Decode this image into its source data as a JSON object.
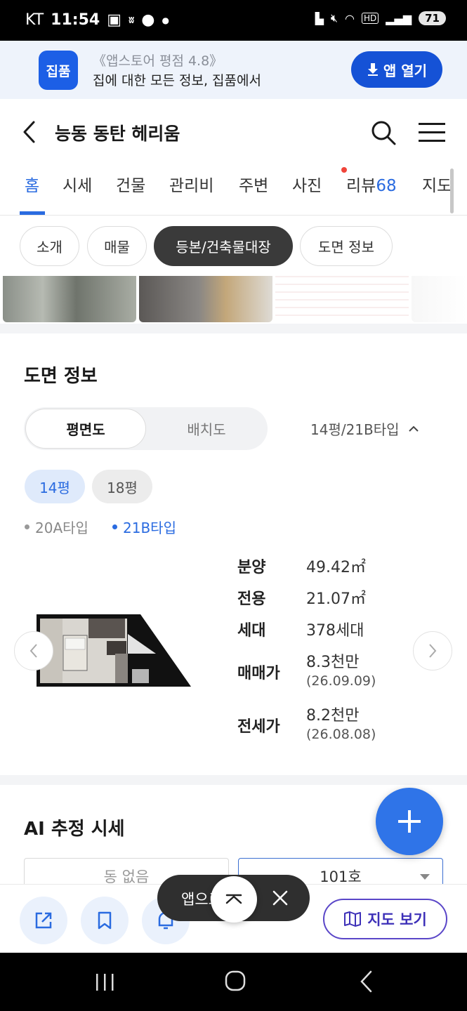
{
  "status_bar": {
    "carrier": "KT",
    "time": "11:54",
    "battery": "71"
  },
  "app_banner": {
    "logo_text": "집품",
    "rating": "《앱스토어 평점 4.8》",
    "description": "집에 대한 모든 정보, 집품에서",
    "open_button": "앱 열기"
  },
  "header": {
    "title": "능동 동탄 헤리움"
  },
  "tabs": [
    {
      "label": "홈"
    },
    {
      "label": "시세"
    },
    {
      "label": "건물"
    },
    {
      "label": "관리비"
    },
    {
      "label": "주변"
    },
    {
      "label": "사진"
    },
    {
      "label": "리뷰",
      "count": "68"
    },
    {
      "label": "지도"
    }
  ],
  "chips": [
    "소개",
    "매물",
    "등본/건축물대장",
    "도면 정보"
  ],
  "floor_plan": {
    "title": "도면 정보",
    "segment": {
      "selected": "평면도",
      "other": "배치도"
    },
    "type_selector": "14평/21B타입",
    "sizes": [
      "14평",
      "18평"
    ],
    "subtypes": [
      "20A타입",
      "21B타입"
    ],
    "info": [
      {
        "label": "분양",
        "value": "49.42㎡",
        "sub": ""
      },
      {
        "label": "전용",
        "value": "21.07㎡",
        "sub": ""
      },
      {
        "label": "세대",
        "value": "378세대",
        "sub": ""
      },
      {
        "label": "매매가",
        "value": "8.3천만",
        "sub": "(26.09.09)"
      },
      {
        "label": "전세가",
        "value": "8.2천만",
        "sub": "(26.08.08)"
      }
    ]
  },
  "ai_section": {
    "title": "AI 추정 시세",
    "dong_select": "동 없음",
    "ho_select": "101호"
  },
  "bottom_bar": {
    "map_button": "지도 보기",
    "toast_text": "앱으로 보기"
  },
  "colors": {
    "accent": "#2a6be0",
    "banner_button": "#1552d6",
    "map_button": "#5a46c8",
    "review_dot": "#f0443a"
  }
}
